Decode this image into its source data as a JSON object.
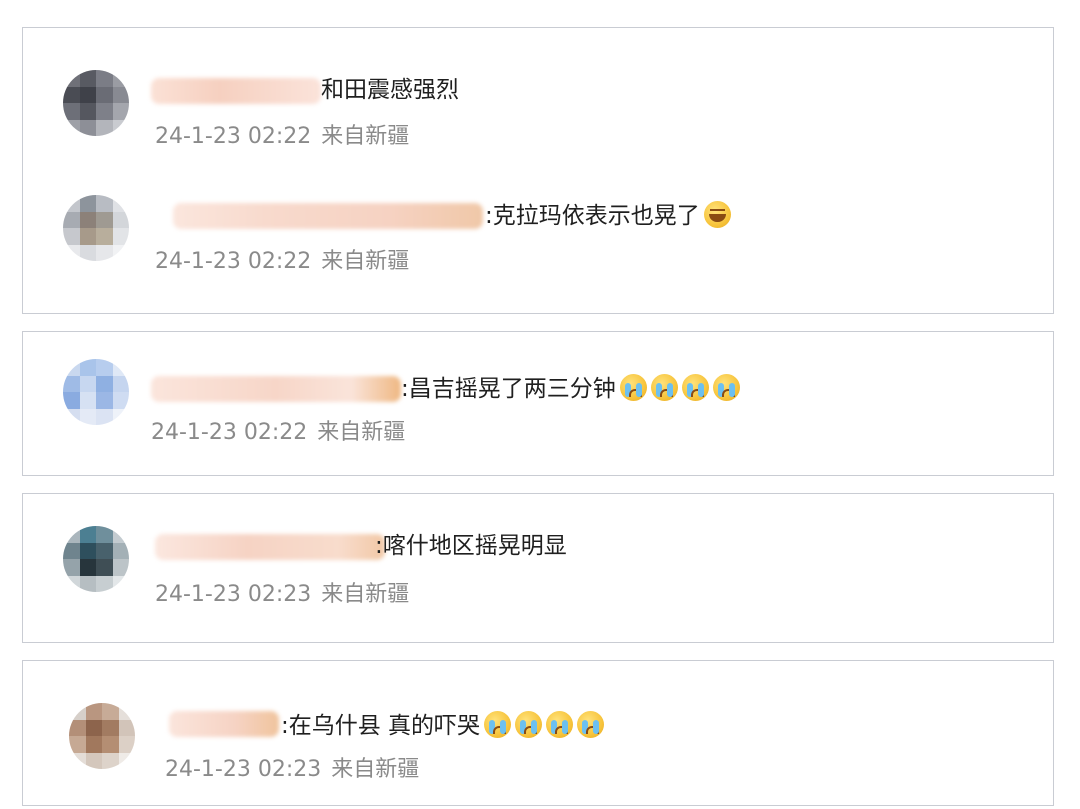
{
  "comments": [
    {
      "text": "和田震感强烈",
      "date": "24-1-23 02:22",
      "location": "来自新疆",
      "emoji_count": 0
    },
    {
      "text": ":克拉玛依表示也晃了",
      "date": "24-1-23 02:22",
      "location": "来自新疆",
      "emoji": "laugh-emoji",
      "emoji_count": 1
    },
    {
      "text": ":昌吉摇晃了两三分钟",
      "date": "24-1-23 02:22",
      "location": "来自新疆",
      "emoji": "cry-emoji",
      "emoji_count": 4
    },
    {
      "text": ":喀什地区摇晃明显",
      "date": "24-1-23 02:23",
      "location": "来自新疆",
      "emoji_count": 0
    },
    {
      "text": ":在乌什县 真的吓哭",
      "date": "24-1-23 02:23",
      "location": "来自新疆",
      "emoji": "cry-emoji",
      "emoji_count": 4
    }
  ],
  "colors": {
    "border": "#c9ccd3",
    "text": "#1f1f1f",
    "meta": "#8a8a8a",
    "name_blur": "#f6d3c4"
  }
}
